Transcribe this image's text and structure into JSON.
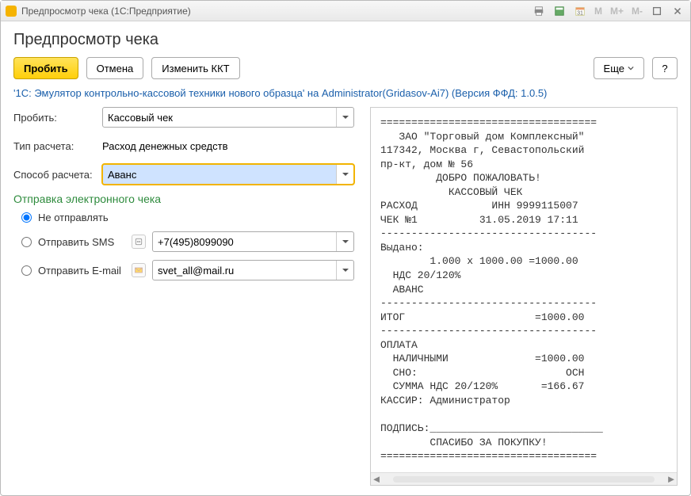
{
  "window": {
    "title": "Предпросмотр чека  (1С:Предприятие)"
  },
  "page": {
    "title": "Предпросмотр чека"
  },
  "toolbar": {
    "submit": "Пробить",
    "cancel": "Отмена",
    "change_kkt": "Изменить ККТ",
    "more": "Еще",
    "help": "?"
  },
  "info_line": "'1С: Эмулятор контрольно-кассовой техники нового образца' на Administrator(Gridasov-Ai7) (Версия ФФД: 1.0.5)",
  "form": {
    "punch_label": "Пробить:",
    "punch_value": "Кассовый чек",
    "calc_type_label": "Тип расчета:",
    "calc_type_value": "Расход денежных средств",
    "calc_method_label": "Способ расчета:",
    "calc_method_value": "Аванс"
  },
  "echeck": {
    "section": "Отправка электронного чека",
    "none": "Не отправлять",
    "sms": "Отправить SMS",
    "sms_value": "+7(495)8099090",
    "email": "Отправить E-mail",
    "email_value": "svet_all@mail.ru"
  },
  "receipt": {
    "lines": [
      "===================================",
      "   ЗАО \"Торговый дом Комплексный\"",
      "117342, Москва г, Севастопольский",
      "пр-кт, дом № 56",
      "         ДОБРО ПОЖАЛОВАТЬ!",
      "           КАССОВЫЙ ЧЕК",
      "РАСХОД            ИНН 9999115007",
      "ЧЕК №1          31.05.2019 17:11",
      "-----------------------------------",
      "Выдано:",
      "        1.000 x 1000.00 =1000.00",
      "  НДС 20/120%",
      "  АВАНС",
      "-----------------------------------",
      "ИТОГ                     =1000.00",
      "-----------------------------------",
      "ОПЛАТА",
      "  НАЛИЧНЫМИ              =1000.00",
      "  СНО:                        ОСН",
      "  СУММА НДС 20/120%       =166.67",
      "КАССИР: Администратор",
      "",
      "ПОДПИСЬ:____________________________",
      "        СПАСИБО ЗА ПОКУПКУ!",
      "==================================="
    ]
  }
}
